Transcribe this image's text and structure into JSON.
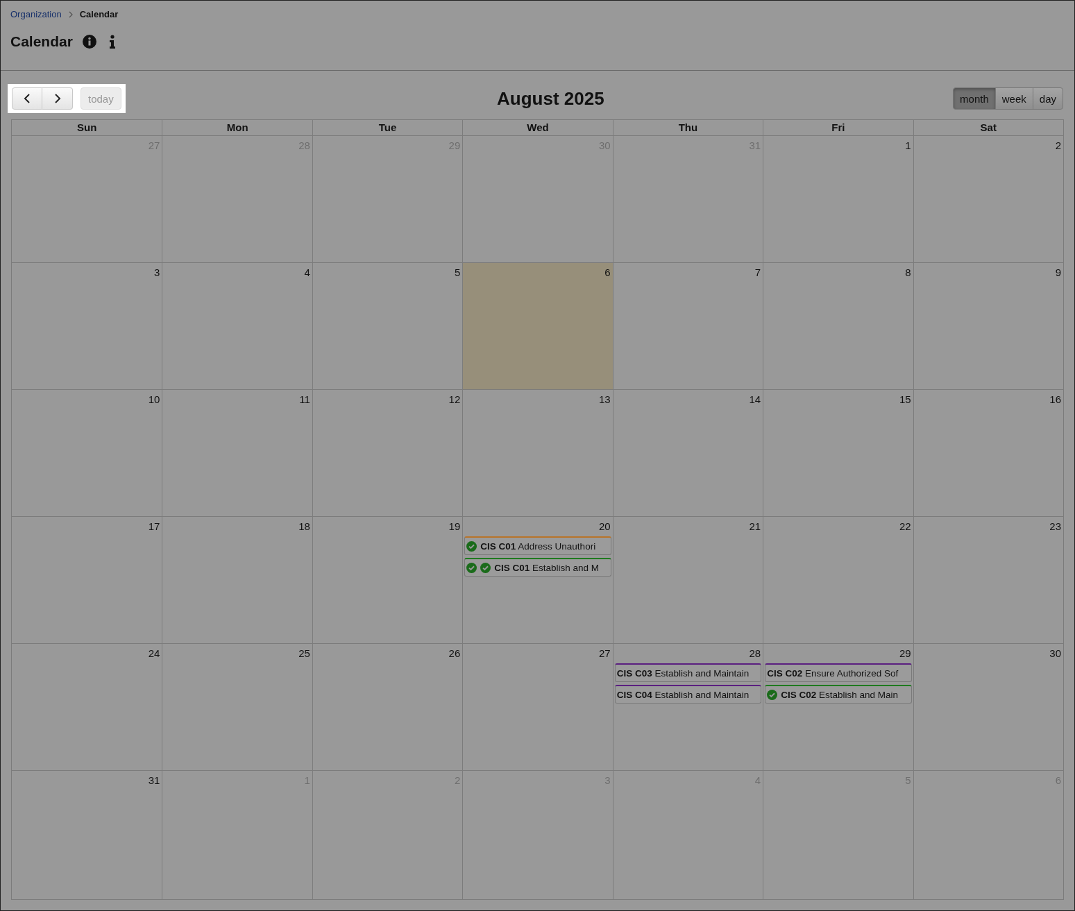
{
  "breadcrumb": [
    {
      "label": "Organization",
      "kind": "link"
    },
    {
      "label": "Calendar",
      "kind": "current"
    }
  ],
  "page_title": "Calendar",
  "toolbar": {
    "today_label": "today",
    "title": "August 2025",
    "views": [
      {
        "label": "month",
        "selected": true
      },
      {
        "label": "week",
        "selected": false
      },
      {
        "label": "day",
        "selected": false
      }
    ]
  },
  "weekdays": [
    "Sun",
    "Mon",
    "Tue",
    "Wed",
    "Thu",
    "Fri",
    "Sat"
  ],
  "weeks": [
    {
      "days": [
        {
          "number": "27",
          "kind": "other"
        },
        {
          "number": "28",
          "kind": "other"
        },
        {
          "number": "29",
          "kind": "other"
        },
        {
          "number": "30",
          "kind": "other"
        },
        {
          "number": "31",
          "kind": "other"
        },
        {
          "number": "1",
          "kind": "current"
        },
        {
          "number": "2",
          "kind": "current"
        }
      ]
    },
    {
      "days": [
        {
          "number": "3",
          "kind": "current"
        },
        {
          "number": "4",
          "kind": "current"
        },
        {
          "number": "5",
          "kind": "current"
        },
        {
          "number": "6",
          "kind": "today"
        },
        {
          "number": "7",
          "kind": "current"
        },
        {
          "number": "8",
          "kind": "current"
        },
        {
          "number": "9",
          "kind": "current"
        }
      ]
    },
    {
      "days": [
        {
          "number": "10",
          "kind": "current"
        },
        {
          "number": "11",
          "kind": "current"
        },
        {
          "number": "12",
          "kind": "current"
        },
        {
          "number": "13",
          "kind": "current"
        },
        {
          "number": "14",
          "kind": "current"
        },
        {
          "number": "15",
          "kind": "current"
        },
        {
          "number": "16",
          "kind": "current"
        }
      ]
    },
    {
      "days": [
        {
          "number": "17",
          "kind": "current"
        },
        {
          "number": "18",
          "kind": "current"
        },
        {
          "number": "19",
          "kind": "current"
        },
        {
          "number": "20",
          "kind": "current",
          "events": [
            {
              "title": "**CIS C01** Address Unauthori",
              "color": "#b8742a",
              "checks": [
                {
                  "kind": "check"
                }
              ]
            },
            {
              "title": "**CIS C01** Establish and M",
              "color": "#1f7a1f",
              "checks": [
                {
                  "kind": "check"
                },
                {
                  "kind": "check"
                }
              ]
            }
          ]
        },
        {
          "number": "21",
          "kind": "current"
        },
        {
          "number": "22",
          "kind": "current"
        },
        {
          "number": "23",
          "kind": "current"
        }
      ]
    },
    {
      "days": [
        {
          "number": "24",
          "kind": "current"
        },
        {
          "number": "25",
          "kind": "current"
        },
        {
          "number": "26",
          "kind": "current"
        },
        {
          "number": "27",
          "kind": "current"
        },
        {
          "number": "28",
          "kind": "current",
          "events": [
            {
              "title": "**CIS C03** Establish and Maintain",
              "color": "#5b1f80"
            },
            {
              "title": "**CIS C04** Establish and Maintain",
              "color": "#5b1f80"
            }
          ]
        },
        {
          "number": "29",
          "kind": "current",
          "events": [
            {
              "title": "**CIS C02** Ensure Authorized Sof",
              "color": "#5b1f80"
            },
            {
              "title": "**CIS C02** Establish and Main",
              "color": "#1f7a1f",
              "checks": [
                {
                  "kind": "check"
                }
              ]
            }
          ]
        },
        {
          "number": "30",
          "kind": "current"
        }
      ]
    },
    {
      "days": [
        {
          "number": "31",
          "kind": "current"
        },
        {
          "number": "1",
          "kind": "other"
        },
        {
          "number": "2",
          "kind": "other"
        },
        {
          "number": "3",
          "kind": "other"
        },
        {
          "number": "4",
          "kind": "other"
        },
        {
          "number": "5",
          "kind": "other"
        },
        {
          "number": "6",
          "kind": "other"
        }
      ]
    }
  ]
}
